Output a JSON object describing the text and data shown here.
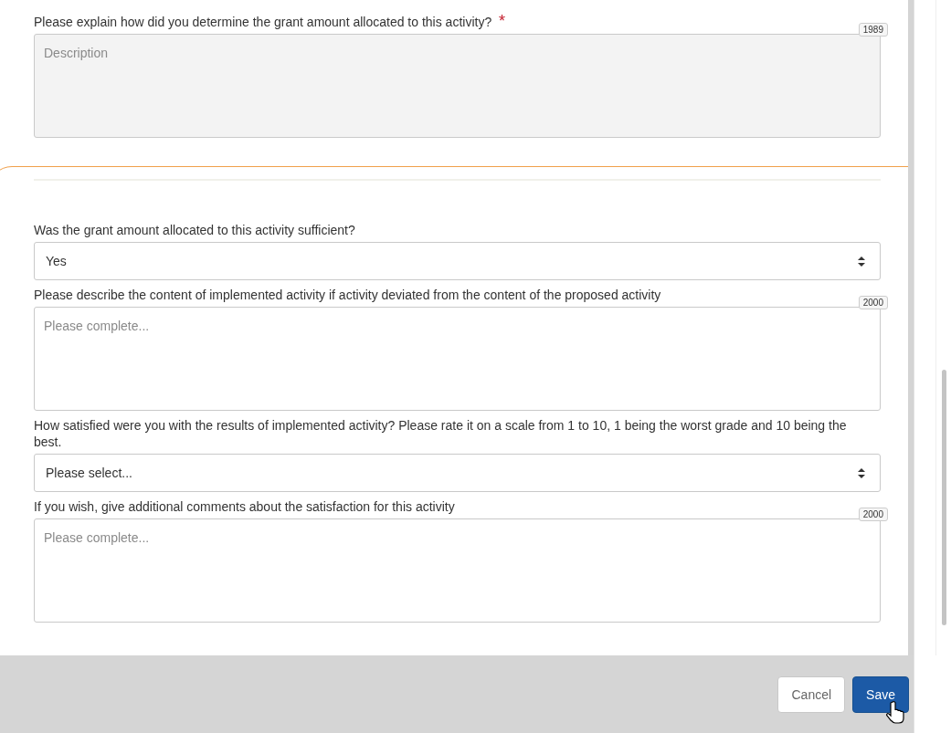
{
  "sections": [
    {
      "highlighted": false,
      "fields": [
        {
          "kind": "textarea",
          "label": "Please explain how did you determine the grant amount allocated to this activity?",
          "required": true,
          "required_mark": "*",
          "placeholder": "Description",
          "counter": "1989",
          "disabled": true
        }
      ]
    },
    {
      "highlighted": true,
      "fields": [
        {
          "kind": "select",
          "label": "Was the grant amount allocated to this activity sufficient?",
          "required": false,
          "value": "Yes"
        },
        {
          "kind": "textarea",
          "label": "Please describe the content of implemented activity if activity deviated from the content of the proposed activity",
          "required": false,
          "placeholder": "Please complete...",
          "counter": "2000",
          "disabled": false
        },
        {
          "kind": "select",
          "label": "How satisfied were you with the results of implemented activity? Please rate it on a scale from 1 to 10, 1 being the worst grade and 10 being the best.",
          "required": false,
          "value": "Please select..."
        },
        {
          "kind": "textarea",
          "label": "If you wish, give additional comments about the satisfaction for this activity",
          "required": false,
          "placeholder": "Please complete...",
          "counter": "2000",
          "disabled": false
        }
      ]
    }
  ],
  "footer": {
    "buttons": [
      {
        "label": "Cancel",
        "kind": "secondary"
      },
      {
        "label": "Save",
        "kind": "primary"
      }
    ]
  }
}
